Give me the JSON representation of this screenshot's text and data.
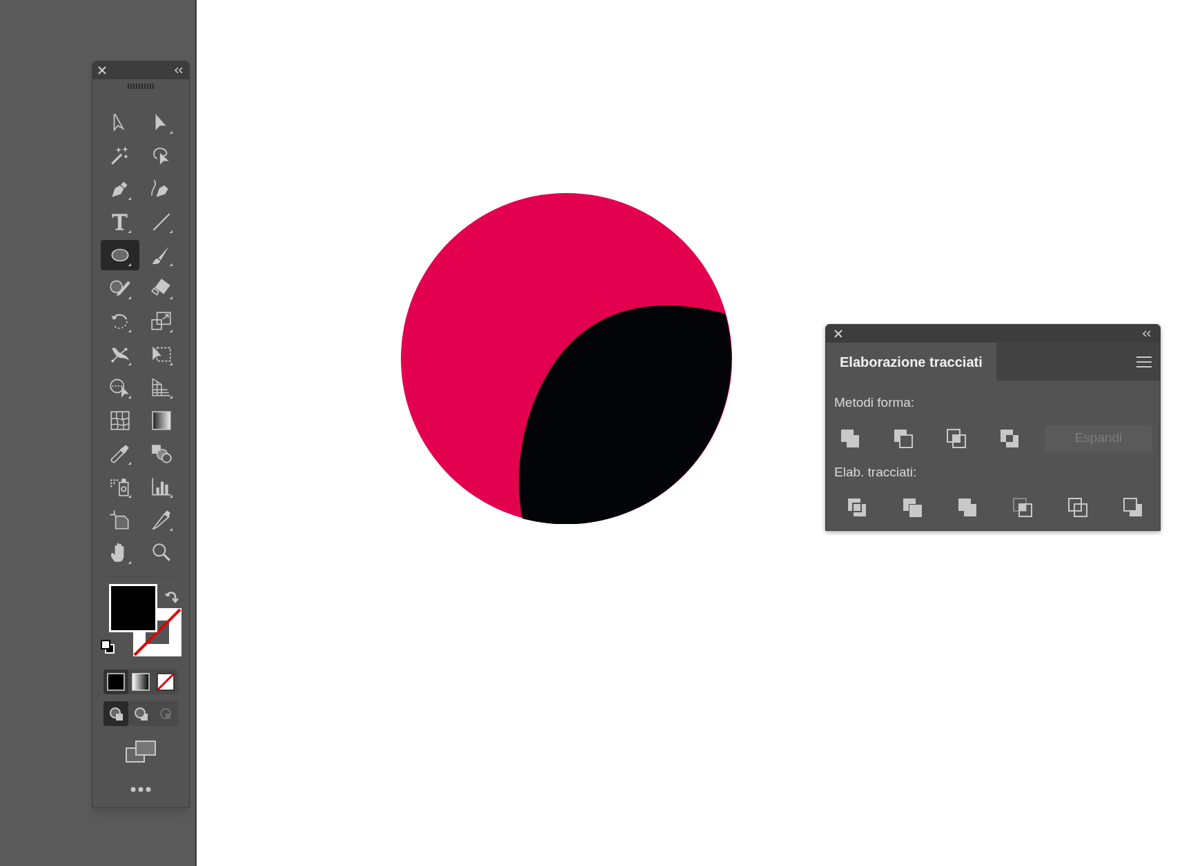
{
  "toolbar": {
    "tools": [
      {
        "kind": "selection",
        "selected": false,
        "submenu": false
      },
      {
        "kind": "direct-selection",
        "selected": false,
        "submenu": true
      },
      {
        "kind": "magic-wand",
        "selected": false,
        "submenu": false
      },
      {
        "kind": "lasso",
        "selected": false,
        "submenu": false
      },
      {
        "kind": "pen",
        "selected": false,
        "submenu": true
      },
      {
        "kind": "curvature",
        "selected": false,
        "submenu": false
      },
      {
        "kind": "type",
        "selected": false,
        "submenu": true
      },
      {
        "kind": "line",
        "selected": false,
        "submenu": true
      },
      {
        "kind": "ellipse",
        "selected": true,
        "submenu": true
      },
      {
        "kind": "paintbrush",
        "selected": false,
        "submenu": true
      },
      {
        "kind": "shaper",
        "selected": false,
        "submenu": true
      },
      {
        "kind": "eraser",
        "selected": false,
        "submenu": true
      },
      {
        "kind": "rotate",
        "selected": false,
        "submenu": true
      },
      {
        "kind": "scale",
        "selected": false,
        "submenu": true
      },
      {
        "kind": "puppet",
        "selected": false,
        "submenu": true
      },
      {
        "kind": "free-transform",
        "selected": false,
        "submenu": true
      },
      {
        "kind": "shape-builder",
        "selected": false,
        "submenu": true
      },
      {
        "kind": "perspective",
        "selected": false,
        "submenu": true
      },
      {
        "kind": "mesh",
        "selected": false,
        "submenu": false
      },
      {
        "kind": "gradient",
        "selected": false,
        "submenu": false
      },
      {
        "kind": "eyedropper",
        "selected": false,
        "submenu": true
      },
      {
        "kind": "blend",
        "selected": false,
        "submenu": false
      },
      {
        "kind": "sprayer",
        "selected": false,
        "submenu": true
      },
      {
        "kind": "graph",
        "selected": false,
        "submenu": true
      },
      {
        "kind": "artboard",
        "selected": false,
        "submenu": false
      },
      {
        "kind": "slice",
        "selected": false,
        "submenu": true
      },
      {
        "kind": "hand",
        "selected": false,
        "submenu": true
      },
      {
        "kind": "zoom",
        "selected": false,
        "submenu": false
      }
    ],
    "stroke_none": true,
    "color_modes": [
      {
        "kind": "color",
        "selected": true
      },
      {
        "kind": "gradient",
        "selected": false
      },
      {
        "kind": "none",
        "selected": false
      }
    ],
    "draw_modes": [
      {
        "kind": "normal",
        "selected": true,
        "disabled": false
      },
      {
        "kind": "behind",
        "selected": false,
        "disabled": false
      },
      {
        "kind": "inside",
        "selected": false,
        "disabled": true
      }
    ]
  },
  "panel": {
    "title": "Elaborazione tracciati",
    "shape_modes_label": "Metodi forma:",
    "shape_modes": [
      {
        "kind": "unite"
      },
      {
        "kind": "minus-front"
      },
      {
        "kind": "intersect"
      },
      {
        "kind": "exclude"
      }
    ],
    "expand_button": {
      "label": "Espandi",
      "disabled": true
    },
    "pathfinders_label": "Elab. tracciati:",
    "pathfinders": [
      {
        "kind": "divide"
      },
      {
        "kind": "trim"
      },
      {
        "kind": "merge"
      },
      {
        "kind": "crop"
      },
      {
        "kind": "outline"
      },
      {
        "kind": "minus-back"
      }
    ]
  }
}
